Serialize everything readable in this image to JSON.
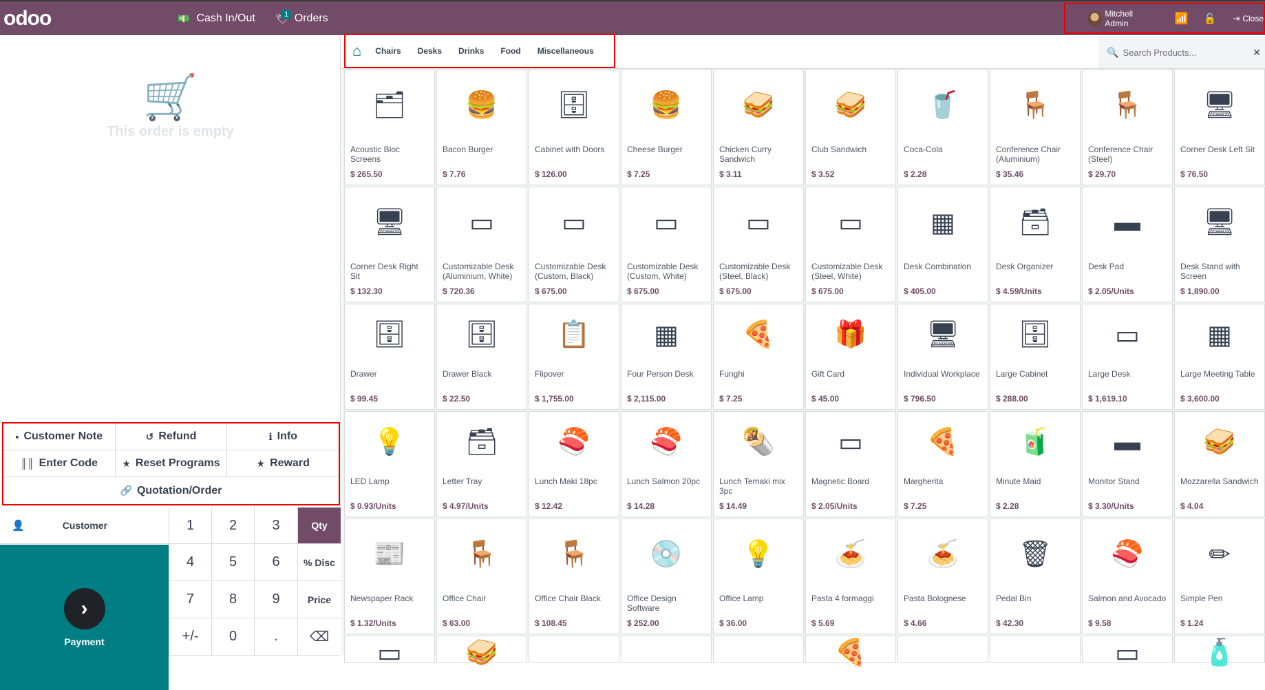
{
  "topbar": {
    "logo": "odoo",
    "cash_label": "Cash In/Out",
    "orders_label": "Orders",
    "orders_badge": "1",
    "user_name": "Mitchell Admin",
    "close_label": "Close"
  },
  "order": {
    "empty_message": "This order is empty"
  },
  "controls": {
    "customer_note": "Customer Note",
    "refund": "Refund",
    "info": "Info",
    "enter_code": "Enter Code",
    "reset_programs": "Reset Programs",
    "reward": "Reward",
    "quotation": "Quotation/Order"
  },
  "pad": {
    "customer": "Customer",
    "payment": "Payment",
    "keys": [
      "1",
      "2",
      "3",
      "Qty",
      "4",
      "5",
      "6",
      "% Disc",
      "7",
      "8",
      "9",
      "Price",
      "+/-",
      "0",
      ".",
      "⌫"
    ],
    "active_mode": "Qty"
  },
  "categories": {
    "items": [
      "Chairs",
      "Desks",
      "Drinks",
      "Food",
      "Miscellaneous"
    ]
  },
  "search": {
    "placeholder": "Search Products..."
  },
  "colors": {
    "brand": "#714B67",
    "teal": "#017e84",
    "highlight": "#e00000"
  },
  "products": [
    {
      "name": "Acoustic Bloc Screens",
      "price": "$ 265.50",
      "icon": "🗂"
    },
    {
      "name": "Bacon Burger",
      "price": "$ 7.76",
      "icon": "🍔"
    },
    {
      "name": "Cabinet with Doors",
      "price": "$ 126.00",
      "icon": "🗄"
    },
    {
      "name": "Cheese Burger",
      "price": "$ 7.25",
      "icon": "🍔"
    },
    {
      "name": "Chicken Curry Sandwich",
      "price": "$ 3.11",
      "icon": "🥪"
    },
    {
      "name": "Club Sandwich",
      "price": "$ 3.52",
      "icon": "🥪"
    },
    {
      "name": "Coca-Cola",
      "price": "$ 2.28",
      "icon": "🥤"
    },
    {
      "name": "Conference Chair (Aluminium)",
      "price": "$ 35.46",
      "icon": "🪑"
    },
    {
      "name": "Conference Chair (Steel)",
      "price": "$ 29.70",
      "icon": "🪑"
    },
    {
      "name": "Corner Desk Left Sit",
      "price": "$ 76.50",
      "icon": "🖥"
    },
    {
      "name": "Corner Desk Right Sit",
      "price": "$ 132.30",
      "icon": "🖥"
    },
    {
      "name": "Customizable Desk (Aluminium, White)",
      "price": "$ 720.36",
      "icon": "▭"
    },
    {
      "name": "Customizable Desk (Custom, Black)",
      "price": "$ 675.00",
      "icon": "▭"
    },
    {
      "name": "Customizable Desk (Custom, White)",
      "price": "$ 675.00",
      "icon": "▭"
    },
    {
      "name": "Customizable Desk (Steel, Black)",
      "price": "$ 675.00",
      "icon": "▭"
    },
    {
      "name": "Customizable Desk (Steel, White)",
      "price": "$ 675.00",
      "icon": "▭"
    },
    {
      "name": "Desk Combination",
      "price": "$ 405.00",
      "icon": "▦"
    },
    {
      "name": "Desk Organizer",
      "price": "$ 4.59/Units",
      "icon": "🗃"
    },
    {
      "name": "Desk Pad",
      "price": "$ 2.05/Units",
      "icon": "▬"
    },
    {
      "name": "Desk Stand with Screen",
      "price": "$ 1,890.00",
      "icon": "🖥"
    },
    {
      "name": "Drawer",
      "price": "$ 99.45",
      "icon": "🗄"
    },
    {
      "name": "Drawer Black",
      "price": "$ 22.50",
      "icon": "🗄"
    },
    {
      "name": "Flipover",
      "price": "$ 1,755.00",
      "icon": "📋"
    },
    {
      "name": "Four Person Desk",
      "price": "$ 2,115.00",
      "icon": "▦"
    },
    {
      "name": "Funghi",
      "price": "$ 7.25",
      "icon": "🍕"
    },
    {
      "name": "Gift Card",
      "price": "$ 45.00",
      "icon": "🎁"
    },
    {
      "name": "Individual Workplace",
      "price": "$ 796.50",
      "icon": "🖥"
    },
    {
      "name": "Large Cabinet",
      "price": "$ 288.00",
      "icon": "🗄"
    },
    {
      "name": "Large Desk",
      "price": "$ 1,619.10",
      "icon": "▭"
    },
    {
      "name": "Large Meeting Table",
      "price": "$ 3,600.00",
      "icon": "▦"
    },
    {
      "name": "LED Lamp",
      "price": "$ 0.93/Units",
      "icon": "💡"
    },
    {
      "name": "Letter Tray",
      "price": "$ 4.97/Units",
      "icon": "🗃"
    },
    {
      "name": "Lunch Maki 18pc",
      "price": "$ 12.42",
      "icon": "🍣"
    },
    {
      "name": "Lunch Salmon 20pc",
      "price": "$ 14.28",
      "icon": "🍣"
    },
    {
      "name": "Lunch Temaki mix 3pc",
      "price": "$ 14.49",
      "icon": "🌯"
    },
    {
      "name": "Magnetic Board",
      "price": "$ 2.05/Units",
      "icon": "▭"
    },
    {
      "name": "Margherita",
      "price": "$ 7.25",
      "icon": "🍕"
    },
    {
      "name": "Minute Maid",
      "price": "$ 2.28",
      "icon": "🧃"
    },
    {
      "name": "Monitor Stand",
      "price": "$ 3.30/Units",
      "icon": "▬"
    },
    {
      "name": "Mozzarella Sandwich",
      "price": "$ 4.04",
      "icon": "🥪"
    },
    {
      "name": "Newspaper Rack",
      "price": "$ 1.32/Units",
      "icon": "📰"
    },
    {
      "name": "Office Chair",
      "price": "$ 63.00",
      "icon": "🪑"
    },
    {
      "name": "Office Chair Black",
      "price": "$ 108.45",
      "icon": "🪑"
    },
    {
      "name": "Office Design Software",
      "price": "$ 252.00",
      "icon": "💿"
    },
    {
      "name": "Office Lamp",
      "price": "$ 36.00",
      "icon": "💡"
    },
    {
      "name": "Pasta 4 formaggi",
      "price": "$ 5.69",
      "icon": "🍝"
    },
    {
      "name": "Pasta Bolognese",
      "price": "$ 4.66",
      "icon": "🍝"
    },
    {
      "name": "Pedal Bin",
      "price": "$ 42.30",
      "icon": "🗑"
    },
    {
      "name": "Salmon and Avocado",
      "price": "$ 9.58",
      "icon": "🍣"
    },
    {
      "name": "Simple Pen",
      "price": "$ 1.24",
      "icon": "✏"
    },
    {
      "name": "",
      "price": "",
      "icon": "▭"
    },
    {
      "name": "",
      "price": "",
      "icon": "🥪"
    },
    {
      "name": "",
      "price": "",
      "icon": ""
    },
    {
      "name": "",
      "price": "",
      "icon": ""
    },
    {
      "name": "",
      "price": "",
      "icon": ""
    },
    {
      "name": "",
      "price": "",
      "icon": "🍕"
    },
    {
      "name": "",
      "price": "",
      "icon": ""
    },
    {
      "name": "",
      "price": "",
      "icon": ""
    },
    {
      "name": "",
      "price": "",
      "icon": "▭"
    },
    {
      "name": "",
      "price": "",
      "icon": "🧴"
    }
  ]
}
